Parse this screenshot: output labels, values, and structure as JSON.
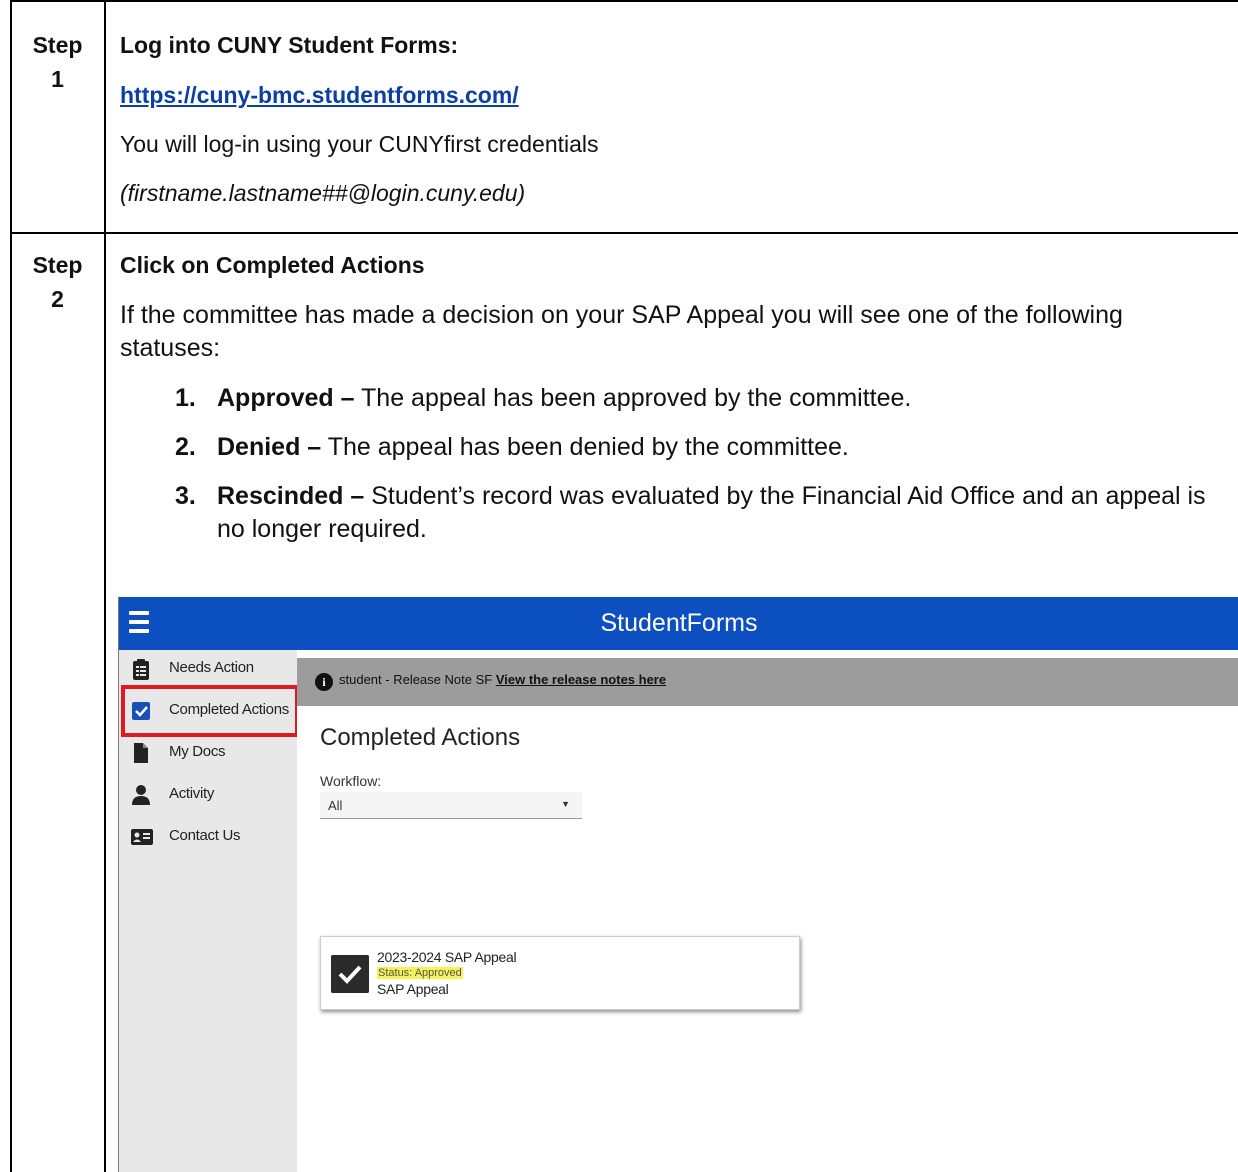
{
  "step1": {
    "label_word": "Step",
    "label_num": "1",
    "heading": "Log into CUNY Student Forms:",
    "link": "https://cuny-bmc.studentforms.com/",
    "login_note": "You will log-in using your CUNYfirst credentials",
    "credentials_format": "(firstname.lastname##@login.cuny.edu)"
  },
  "step2": {
    "label_word": "Step",
    "label_num": "2",
    "heading": "Click on Completed Actions",
    "intro": "If the committee has made a decision on your SAP Appeal you will see one of the following statuses:",
    "statuses": [
      {
        "num": "1.",
        "name": "Approved –",
        "desc": " The appeal has been approved by the committee."
      },
      {
        "num": "2.",
        "name": "Denied –",
        "desc": " The appeal has been denied by the committee."
      },
      {
        "num": "3.",
        "name": "Rescinded –",
        "desc": " Student’s record was evaluated by the Financial Aid Office and an appeal is no longer required."
      }
    ]
  },
  "screenshot": {
    "app_title": "StudentForms",
    "nav": [
      {
        "label": "Needs Action",
        "icon": "clipboard-icon"
      },
      {
        "label": "Completed Actions",
        "icon": "checkbox-icon"
      },
      {
        "label": "My Docs",
        "icon": "document-icon"
      },
      {
        "label": "Activity",
        "icon": "person-icon"
      },
      {
        "label": "Contact Us",
        "icon": "contact-card-icon"
      }
    ],
    "release_note": "student - Release Note SF ",
    "release_link": "View the release notes here",
    "page_heading": "Completed Actions",
    "workflow_label": "Workflow:",
    "workflow_value": "All",
    "card": {
      "title": "2023-2024 SAP Appeal",
      "status": "Status: Approved",
      "subtitle": "SAP Appeal"
    },
    "highlight_color": "#e01a22",
    "topbar_color": "#0b4fc1"
  }
}
